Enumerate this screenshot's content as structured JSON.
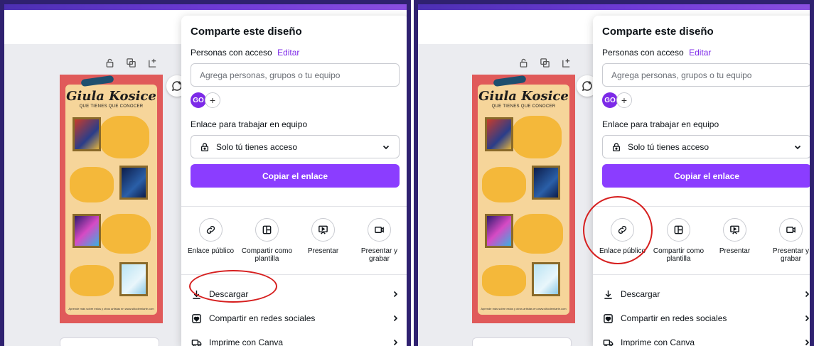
{
  "panels": [
    {
      "toolbar_icons": [
        "lock-icon",
        "duplicate-icon",
        "add-page-icon"
      ],
      "poster": {
        "title": "Giula Kosice",
        "subtitle": "QUE TIENES QUE CONOCER",
        "footer": "Aprende más sobre estos y otros artistas en www.sitiodemiarte.com"
      },
      "share": {
        "title": "Comparte este diseño",
        "access_label": "Personas con acceso",
        "edit_label": "Editar",
        "people_placeholder": "Agrega personas, grupos o tu equipo",
        "avatar_initials": "GO",
        "avatar_add": "+",
        "team_link_label": "Enlace para trabajar en equipo",
        "access_value": "Solo tú tienes acceso",
        "copy_button": "Copiar el enlace",
        "options": [
          {
            "icon": "link-icon",
            "label": "Enlace público"
          },
          {
            "icon": "template-icon",
            "label": "Compartir como plantilla"
          },
          {
            "icon": "present-icon",
            "label": "Presentar"
          },
          {
            "icon": "record-icon",
            "label": "Presentar y grabar"
          }
        ],
        "menu": [
          {
            "icon": "download-icon",
            "label": "Descargar"
          },
          {
            "icon": "social-icon",
            "label": "Compartir en redes sociales"
          },
          {
            "icon": "truck-icon",
            "label": "Imprime con Canva"
          }
        ]
      },
      "highlighted": "Descargar"
    },
    {
      "toolbar_icons": [
        "lock-icon",
        "duplicate-icon",
        "add-page-icon"
      ],
      "poster": {
        "title": "Giula Kosice",
        "subtitle": "QUE TIENES QUE CONOCER",
        "footer": "Aprende más sobre estos y otros artistas en www.sitiodemiarte.com"
      },
      "share": {
        "title": "Comparte este diseño",
        "access_label": "Personas con acceso",
        "edit_label": "Editar",
        "people_placeholder": "Agrega personas, grupos o tu equipo",
        "avatar_initials": "GO",
        "avatar_add": "+",
        "team_link_label": "Enlace para trabajar en equipo",
        "access_value": "Solo tú tienes acceso",
        "copy_button": "Copiar el enlace",
        "options": [
          {
            "icon": "link-icon",
            "label": "Enlace público"
          },
          {
            "icon": "template-icon",
            "label": "Compartir como plantilla"
          },
          {
            "icon": "present-icon",
            "label": "Presentar"
          },
          {
            "icon": "record-icon",
            "label": "Presentar y grabar"
          }
        ],
        "menu": [
          {
            "icon": "download-icon",
            "label": "Descargar"
          },
          {
            "icon": "social-icon",
            "label": "Compartir en redes sociales"
          },
          {
            "icon": "truck-icon",
            "label": "Imprime con Canva"
          }
        ]
      },
      "highlighted": "Enlace público"
    }
  ],
  "colors": {
    "accent": "#8b3dff",
    "edit_link": "#7d2ae8",
    "frame": "#2f2170",
    "highlight_circle": "#d61f1f",
    "poster_border": "#e05a5a",
    "poster_bg": "#f6d59a"
  }
}
